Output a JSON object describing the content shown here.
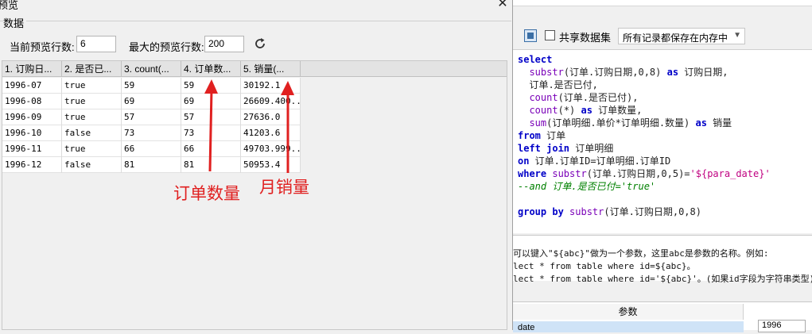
{
  "dialog": {
    "title": "预览",
    "group_label": "数据",
    "current_rows_label": "当前预览行数:",
    "current_rows_value": "6",
    "max_rows_label": "最大的预览行数:",
    "max_rows_value": "200",
    "refresh_icon": "refresh-icon",
    "close_icon": "close-icon"
  },
  "grid": {
    "columns": [
      "1. 订购日...",
      "2. 是否已...",
      "3. count(...",
      "4. 订单数...",
      "5. 销量(..."
    ],
    "rows": [
      [
        "1996-07",
        "true",
        "59",
        "59",
        "30192.1"
      ],
      [
        "1996-08",
        "true",
        "69",
        "69",
        "26609.400..."
      ],
      [
        "1996-09",
        "true",
        "57",
        "57",
        "27636.0"
      ],
      [
        "1996-10",
        "false",
        "73",
        "73",
        "41203.6"
      ],
      [
        "1996-11",
        "true",
        "66",
        "66",
        "49703.999..."
      ],
      [
        "1996-12",
        "false",
        "81",
        "81",
        "50953.4"
      ]
    ]
  },
  "annotations": {
    "order_count": "订单数量",
    "monthly_sales": "月销量",
    "color": "#e02020"
  },
  "editor": {
    "share_label": "共享数据集",
    "memory_option": "所有记录都保存在内存中",
    "sql_lines": [
      [
        "select"
      ],
      [
        "  substr(订单.订购日期,0,8) as 订购日期,"
      ],
      [
        "  订单.是否已付,"
      ],
      [
        "  count(订单.是否已付),"
      ],
      [
        "  count(*) as 订单数量,"
      ],
      [
        "  sum(订单明细.单价*订单明细.数量) as 销量"
      ],
      [
        "from 订单"
      ],
      [
        "left join 订单明细"
      ],
      [
        "on 订单.订单ID=订单明细.订单ID"
      ],
      [
        "where substr(订单.订购日期,0,5)='${para_date}'"
      ],
      [
        "--and 订单.是否已付='true'"
      ],
      [
        ""
      ],
      [
        "group by substr(订单.订购日期,0,8)"
      ]
    ],
    "hint_lines": [
      "可以键入\"${abc}\"做为一个参数，这里abc是参数的名称。例如:",
      "lect * from table where id=${abc}。",
      "lect * from table where id='${abc}'。(如果id字段为字符串类型)"
    ],
    "params_header": "参数",
    "param_name": "date",
    "param_value": "1996"
  }
}
